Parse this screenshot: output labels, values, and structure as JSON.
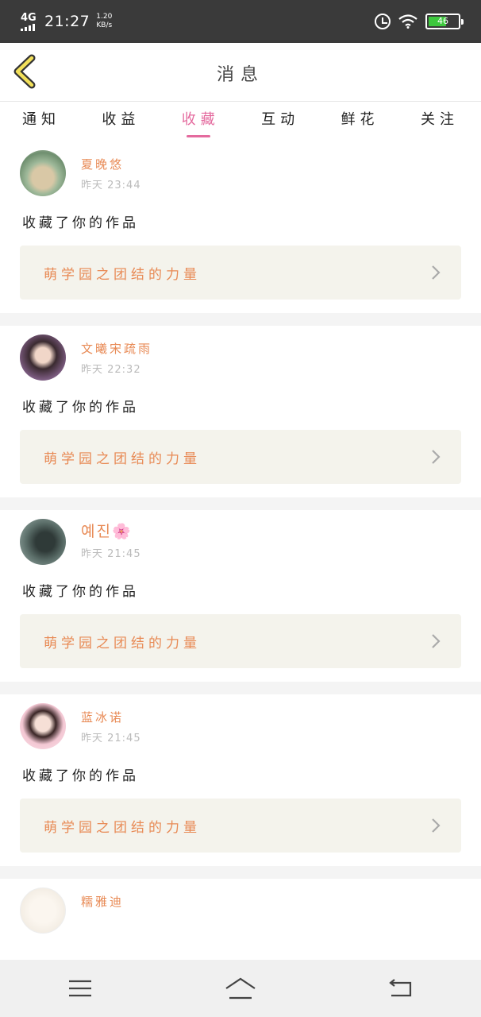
{
  "status_bar": {
    "network": "4G",
    "time": "21:27",
    "speed_value": "1.20",
    "speed_unit": "KB/s",
    "battery": "46"
  },
  "header": {
    "title": "消息"
  },
  "tabs": [
    {
      "label": "通知"
    },
    {
      "label": "收益"
    },
    {
      "label": "收藏",
      "active": true
    },
    {
      "label": "互动"
    },
    {
      "label": "鲜花"
    },
    {
      "label": "关注"
    }
  ],
  "messages": [
    {
      "user": "夏晚悠",
      "time": "昨天 23:44",
      "action": "收藏了你的作品",
      "work_title": "萌学园之团结的力量",
      "avatar_icon": "avatar-photo"
    },
    {
      "user": "文曦宋疏雨",
      "time": "昨天 22:32",
      "action": "收藏了你的作品",
      "work_title": "萌学园之团结的力量",
      "avatar_icon": "avatar-photo"
    },
    {
      "user": "예진🌸",
      "time": "昨天 21:45",
      "action": "收藏了你的作品",
      "work_title": "萌学园之团结的力量",
      "avatar_icon": "avatar-photo"
    },
    {
      "user": "蓝冰诺",
      "time": "昨天 21:45",
      "action": "收藏了你的作品",
      "work_title": "萌学园之团结的力量",
      "avatar_icon": "avatar-photo"
    },
    {
      "user": "糯雅迪",
      "time": "",
      "action": "",
      "work_title": "",
      "avatar_icon": "avatar-photo"
    }
  ],
  "nav_bar": {
    "icons": [
      "menu-icon",
      "home-icon",
      "back-icon"
    ]
  },
  "colors": {
    "accent": "#e46a9e",
    "name": "#e88a55",
    "card_bg": "#f4f3ec",
    "status_bg": "#3a3a3a"
  }
}
